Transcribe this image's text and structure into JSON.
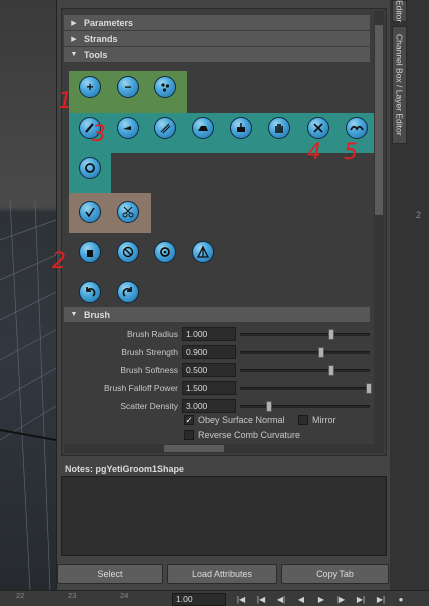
{
  "side_tabs": {
    "editor_tab": "Editor",
    "channel_tab": "Channel Box / Layer Editor",
    "edge_mark": "2"
  },
  "sections": {
    "parameters": "Parameters",
    "strands": "Strands",
    "tools": "Tools",
    "brush": "Brush"
  },
  "annotations": [
    "1",
    "2",
    "3",
    "4",
    "5"
  ],
  "brush": {
    "rows": [
      {
        "label": "Brush Radius",
        "value": "1.000"
      },
      {
        "label": "Brush Strength",
        "value": "0.900"
      },
      {
        "label": "Brush Softness",
        "value": "0.500"
      },
      {
        "label": "Brush Falloff Power",
        "value": "1.500"
      },
      {
        "label": "Scatter Density",
        "value": "3.000"
      }
    ],
    "obey_surface_normal": "Obey Surface Normal",
    "mirror": "Mirror",
    "reverse_comb": "Reverse Comb Curvature"
  },
  "notes": {
    "label": "Notes:  pgYetiGroom1Shape"
  },
  "buttons": {
    "select": "Select",
    "load_attributes": "Load Attributes",
    "copy_tab": "Copy Tab"
  },
  "timeline": {
    "ticks": [
      "22",
      "23",
      "24"
    ],
    "current_frame": "1.00"
  },
  "colors": {
    "green_group": "#5a8a4c",
    "teal_group": "#2f8f86",
    "tan_group": "#8a776a",
    "annotation": "#e02020"
  }
}
